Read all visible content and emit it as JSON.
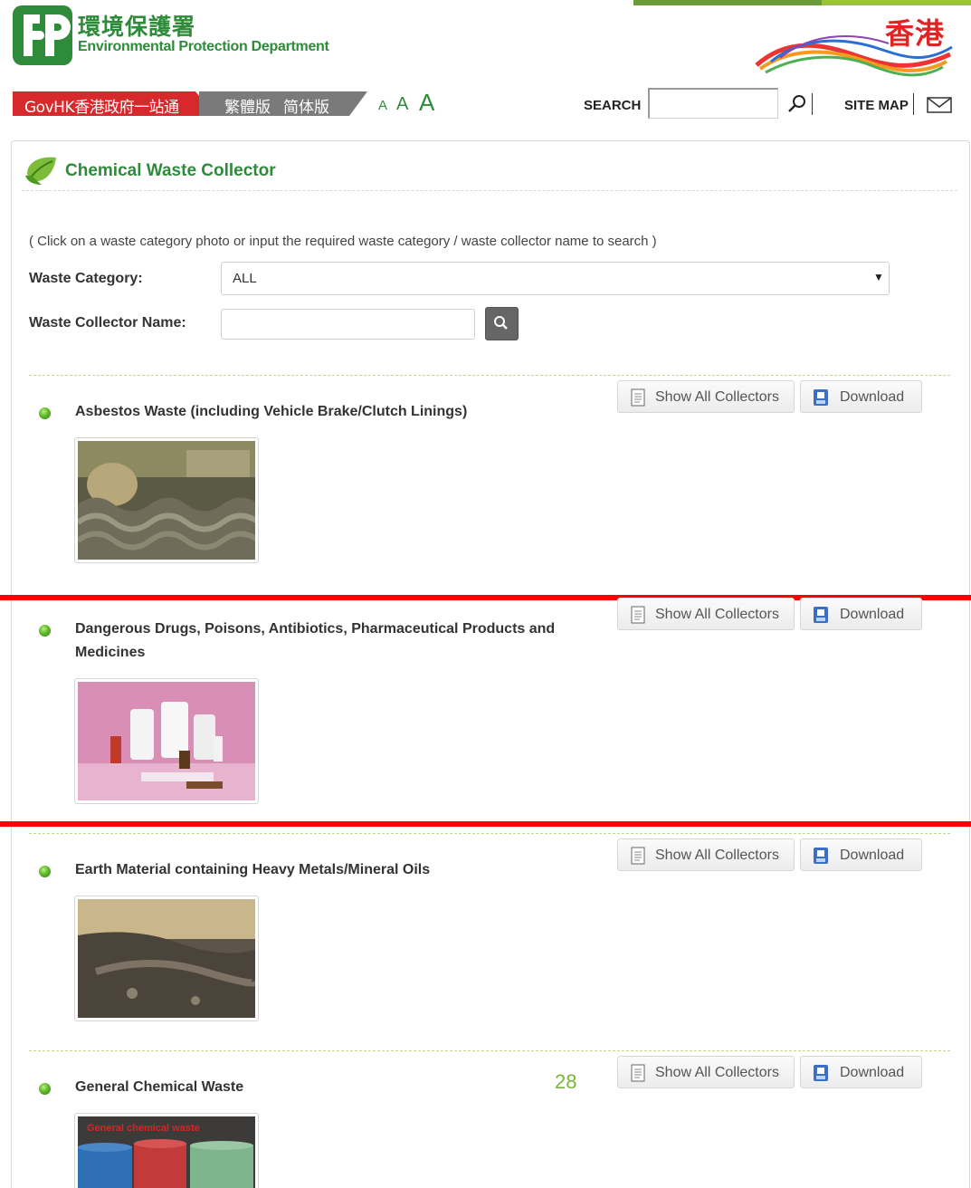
{
  "header": {
    "department_zh": "環境保護署",
    "department_en": "Environmental Protection Department",
    "hk_zh": "香港",
    "govhk": "GovHK香港政府一站通",
    "lang_tc": "繁體版",
    "lang_sc": "简体版",
    "font_small": "A",
    "font_medium": "A",
    "font_large": "A",
    "search_label": "SEARCH",
    "search_value": "",
    "sitemap": "SITE MAP"
  },
  "page": {
    "title": "Chemical Waste Collector",
    "instruction": "( Click on a waste category photo or input the required waste category / waste collector name to search )",
    "waste_category_label": "Waste Category:",
    "waste_category_value": "ALL",
    "collector_name_label": "Waste Collector Name:",
    "collector_name_value": ""
  },
  "buttons": {
    "show_all": "Show All Collectors",
    "download": "Download"
  },
  "categories": [
    {
      "title": "Asbestos Waste (including Vehicle Brake/Clutch Linings)"
    },
    {
      "title_line1": "Dangerous Drugs, Poisons, Antibiotics, Pharmaceutical Products and",
      "title_line2": "Medicines"
    },
    {
      "title": "Earth Material containing Heavy Metals/Mineral Oils"
    },
    {
      "title": "General Chemical Waste",
      "photo_caption": "General chemical waste"
    }
  ],
  "page_number": "28",
  "colors": {
    "brand_green": "#2e8b3a",
    "govhk_red": "#d7282c",
    "annotation_red": "#ff0000",
    "page_number_green": "#7ab53a"
  }
}
